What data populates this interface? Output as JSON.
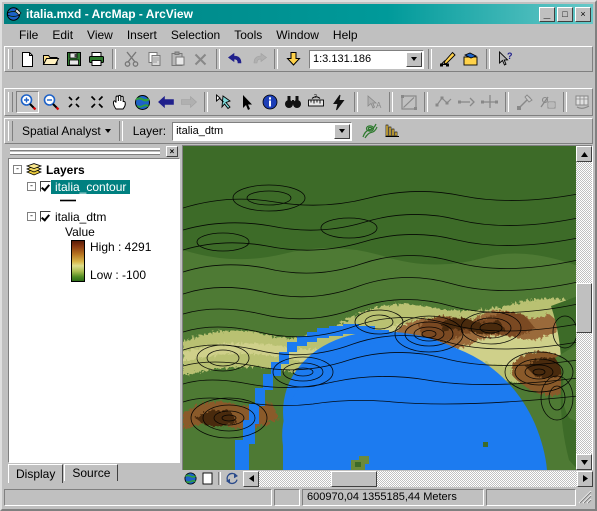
{
  "window": {
    "title": "italia.mxd - ArcMap - ArcView",
    "icon": "arcmap-globe-icon",
    "minimize_label": "_",
    "maximize_label": "□",
    "close_label": "×"
  },
  "menu": {
    "items": [
      {
        "label": "File"
      },
      {
        "label": "Edit"
      },
      {
        "label": "View"
      },
      {
        "label": "Insert"
      },
      {
        "label": "Selection"
      },
      {
        "label": "Tools"
      },
      {
        "label": "Window"
      },
      {
        "label": "Help"
      }
    ]
  },
  "standard_toolbar": {
    "buttons": [
      {
        "name": "new-document-icon",
        "tooltip": "New"
      },
      {
        "name": "open-folder-icon",
        "tooltip": "Open"
      },
      {
        "name": "save-floppy-icon",
        "tooltip": "Save"
      },
      {
        "name": "print-icon",
        "tooltip": "Print"
      },
      {
        "name": "cut-scissors-icon",
        "tooltip": "Cut"
      },
      {
        "name": "copy-icon",
        "tooltip": "Copy"
      },
      {
        "name": "paste-icon",
        "tooltip": "Paste"
      },
      {
        "name": "delete-x-icon",
        "tooltip": "Delete"
      },
      {
        "name": "undo-arrow-icon",
        "tooltip": "Undo"
      },
      {
        "name": "redo-arrow-icon",
        "tooltip": "Redo"
      },
      {
        "name": "add-data-icon",
        "tooltip": "Add Data"
      }
    ],
    "scale": {
      "label": "scale-combo",
      "value": "1:3.131.186"
    },
    "right_buttons": [
      {
        "name": "editor-toolbar-icon",
        "tooltip": "Editor Toolbar"
      },
      {
        "name": "arctoolbox-icon",
        "tooltip": "ArcToolbox"
      },
      {
        "name": "context-help-icon",
        "tooltip": "What's This?"
      }
    ]
  },
  "tools_toolbar": {
    "buttons": [
      {
        "name": "zoom-in-icon",
        "tooltip": "Zoom In",
        "pressed": true
      },
      {
        "name": "zoom-out-icon",
        "tooltip": "Zoom Out"
      },
      {
        "name": "fixed-zoom-in-icon",
        "tooltip": "Fixed Zoom In"
      },
      {
        "name": "fixed-zoom-out-icon",
        "tooltip": "Fixed Zoom Out"
      },
      {
        "name": "pan-hand-icon",
        "tooltip": "Pan"
      },
      {
        "name": "full-extent-globe-icon",
        "tooltip": "Full Extent"
      },
      {
        "name": "back-extent-icon",
        "tooltip": "Go Back To Previous Extent"
      },
      {
        "name": "forward-extent-icon",
        "tooltip": "Go To Next Extent"
      },
      {
        "name": "select-features-icon",
        "tooltip": "Select Features"
      },
      {
        "name": "select-elements-arrow-icon",
        "tooltip": "Select Elements"
      },
      {
        "name": "identify-info-icon",
        "tooltip": "Identify"
      },
      {
        "name": "find-binoculars-icon",
        "tooltip": "Find"
      },
      {
        "name": "measure-ruler-icon",
        "tooltip": "Measure"
      },
      {
        "name": "hyperlink-lightning-icon",
        "tooltip": "Hyperlink"
      },
      {
        "name": "label-text-icon",
        "tooltip": "Label",
        "disabled": true
      },
      {
        "name": "sketch-rectangle-icon",
        "tooltip": "Sketch",
        "disabled": true
      },
      {
        "name": "edit-vertex-icon",
        "tooltip": "Edit Vertices",
        "disabled": true
      },
      {
        "name": "split-tool-icon",
        "tooltip": "Split Tool",
        "disabled": true
      },
      {
        "name": "trace-tool-icon",
        "tooltip": "Trace Tool",
        "disabled": true
      },
      {
        "name": "rotate-tool-icon",
        "tooltip": "Rotate",
        "disabled": true
      },
      {
        "name": "attributes-icon",
        "tooltip": "Attributes",
        "disabled": true
      },
      {
        "name": "table-icon",
        "tooltip": "Open Table",
        "disabled": true
      },
      {
        "name": "help-question-icon",
        "tooltip": "Help",
        "disabled": true
      }
    ]
  },
  "spatial_analyst_toolbar": {
    "menu_label": "Spatial Analyst",
    "layer_label": "Layer:",
    "layer_value": "italia_dtm",
    "buttons": [
      {
        "name": "contour-tool-icon",
        "tooltip": "Contour"
      },
      {
        "name": "histogram-icon",
        "tooltip": "Histogram"
      }
    ]
  },
  "toc": {
    "close_label": "×",
    "root": {
      "label": "Layers",
      "expander": "-"
    },
    "layers": [
      {
        "name": "italia_contour",
        "label": "italia_contour",
        "expander": "-",
        "checked": true,
        "selected": true,
        "symbol": "contour-line-symbol"
      },
      {
        "name": "italia_dtm",
        "label": "italia_dtm",
        "expander": "-",
        "checked": true,
        "selected": false,
        "legend_heading": "Value",
        "high_label": "High : 4291",
        "low_label": "Low : -100",
        "ramp_high_color": "#5a1b08",
        "ramp_low_color": "#2e6b18"
      }
    ],
    "tabs": [
      {
        "label": "Display",
        "active": true
      },
      {
        "label": "Source",
        "active": false
      }
    ]
  },
  "map": {
    "sea_color": "#1c7bf0",
    "lowland_color": "#4e7a34",
    "midland_color": "#c9cd7d",
    "highland_color": "#8a5a32",
    "peak_color": "#3d1a08",
    "contour_color": "#000000",
    "scrollbar": {
      "up_arrow": "▲",
      "down_arrow": "▼",
      "left_arrow": "◄",
      "right_arrow": "►"
    }
  },
  "view_toolbar": {
    "buttons": [
      {
        "name": "data-view-globe-icon",
        "tooltip": "Data View"
      },
      {
        "name": "layout-view-page-icon",
        "tooltip": "Layout View"
      },
      {
        "name": "refresh-view-icon",
        "tooltip": "Refresh View"
      }
    ]
  },
  "statusbar": {
    "message": "",
    "mode": "",
    "coordinates": "600970,04  1355185,44 Meters",
    "extra": ""
  }
}
